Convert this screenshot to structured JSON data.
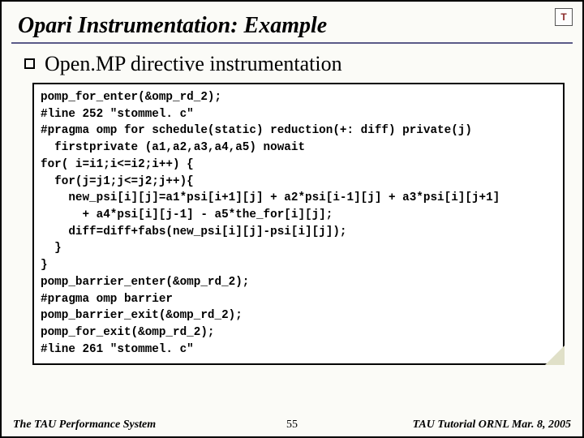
{
  "title": "Opari Instrumentation: Example",
  "logo_text": "T",
  "subtitle": "Open.MP directive instrumentation",
  "code_lines": [
    "pomp_for_enter(&omp_rd_2);",
    "#line 252 \"stommel. c\"",
    "#pragma omp for schedule(static) reduction(+: diff) private(j)",
    "  firstprivate (a1,a2,a3,a4,a5) nowait",
    "for( i=i1;i<=i2;i++) {",
    "  for(j=j1;j<=j2;j++){",
    "    new_psi[i][j]=a1*psi[i+1][j] + a2*psi[i-1][j] + a3*psi[i][j+1]",
    "      + a4*psi[i][j-1] - a5*the_for[i][j];",
    "    diff=diff+fabs(new_psi[i][j]-psi[i][j]);",
    "  }",
    "}",
    "pomp_barrier_enter(&omp_rd_2);",
    "#pragma omp barrier",
    "pomp_barrier_exit(&omp_rd_2);",
    "pomp_for_exit(&omp_rd_2);",
    "#line 261 \"stommel. c\""
  ],
  "footer": {
    "left": "The TAU Performance System",
    "center": "55",
    "right": "TAU Tutorial ORNL Mar. 8, 2005"
  }
}
